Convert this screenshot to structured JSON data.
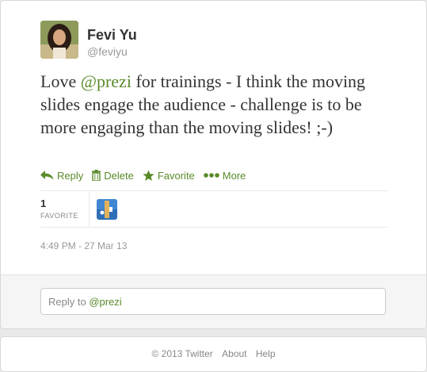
{
  "tweet": {
    "author_name": "Fevi Yu",
    "author_handle": "@feviyu",
    "text_before": "Love ",
    "mention": "@prezi",
    "text_after": " for trainings - I think the moving slides engage the audience - challenge is to be more engaging than the moving slides! ;-)",
    "timestamp": "4:49 PM - 27 Mar 13"
  },
  "actions": {
    "reply": "Reply",
    "delete": "Delete",
    "favorite": "Favorite",
    "more": "More"
  },
  "stats": {
    "favorite_count": "1",
    "favorite_label": "FAVORITE"
  },
  "reply_box": {
    "prefix": "Reply to ",
    "mention": "@prezi"
  },
  "footer": {
    "copyright": "© 2013 Twitter",
    "about": "About",
    "help": "Help"
  },
  "colors": {
    "link": "#5a8a2a",
    "text": "#333333",
    "muted": "#999999"
  },
  "icons": {
    "reply": "reply-arrow-icon",
    "delete": "trash-icon",
    "favorite": "star-icon",
    "more": "dots-icon"
  }
}
